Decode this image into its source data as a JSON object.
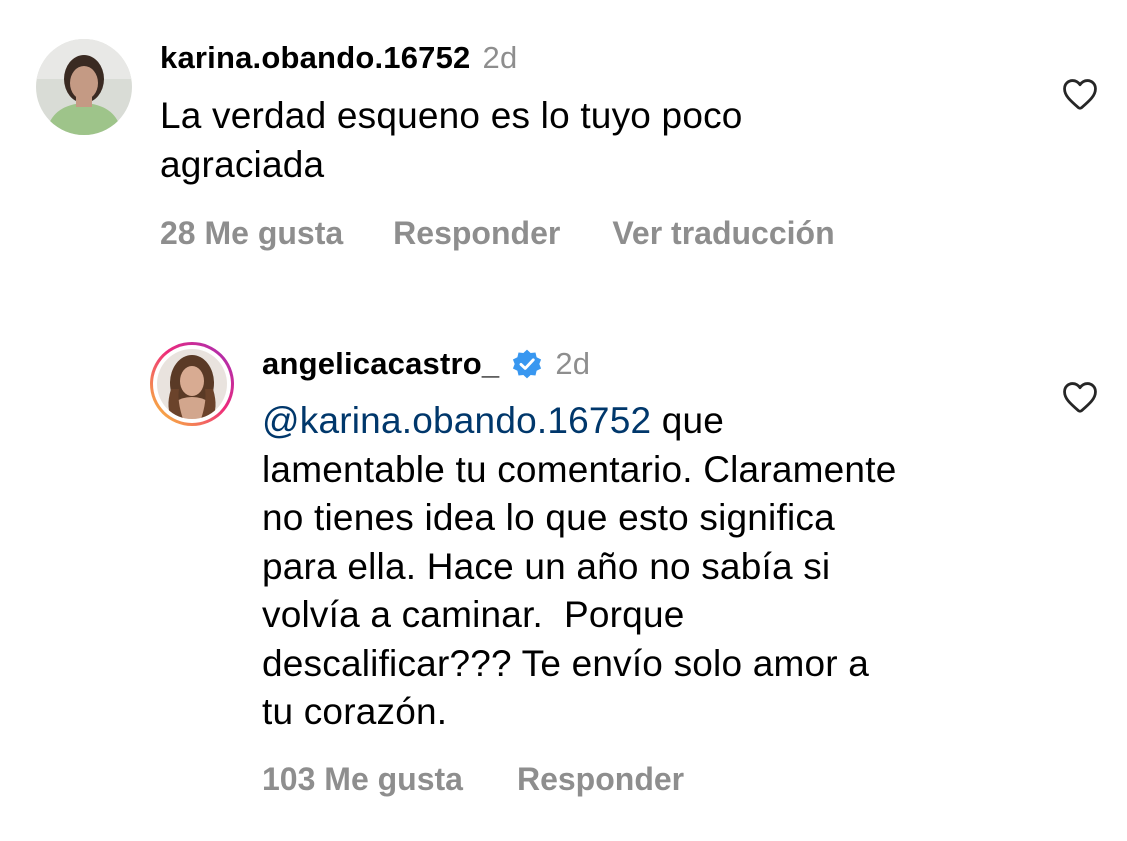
{
  "comments": [
    {
      "username": "karina.obando.16752",
      "time": "2d",
      "text": "La verdad esqueno es lo tuyo poco agraciada",
      "text_lines": [
        "La verdad esqueno es lo tuyo poco",
        "agraciada"
      ],
      "likes": "28 Me gusta",
      "reply": "Responder",
      "translate": "Ver traducción"
    },
    {
      "username": "angelicacastro_",
      "verified": true,
      "time": "2d",
      "mention": "@karina.obando.16752",
      "text_after_mention": " que",
      "text_lines": [
        "lamentable tu comentario. Claramente",
        "no tienes idea lo que esto significa",
        "para ella. Hace un año no sabía si",
        "volvía a caminar.  Porque",
        "descalificar??? Te envío solo amor a",
        "tu corazón."
      ],
      "likes": "103 Me gusta",
      "reply": "Responder"
    }
  ],
  "colors": {
    "text": "#000000",
    "secondary": "#8e8e8e",
    "mention": "#00376b",
    "verified": "#3897f0"
  },
  "icons": [
    "heart-icon",
    "verified-badge-icon"
  ]
}
